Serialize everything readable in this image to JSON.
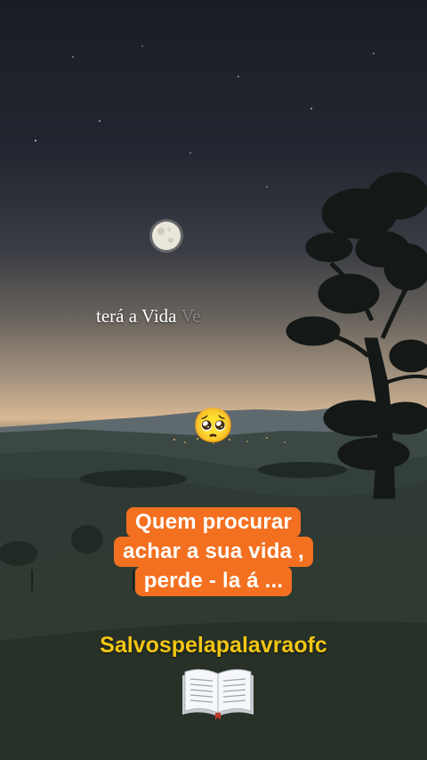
{
  "video": {
    "overlay_text": "terá a Vida ",
    "overlay_text_fading": "Ve",
    "emoji": "🥺",
    "caption_lines": [
      "Quem procurar",
      "achar a sua vida ,",
      "perde - la á ..."
    ],
    "handle": "Salvospelapalavraofc",
    "book_icon": "open-book-icon"
  },
  "colors": {
    "caption_bg": "#f37021",
    "handle_text": "#f3c614"
  }
}
